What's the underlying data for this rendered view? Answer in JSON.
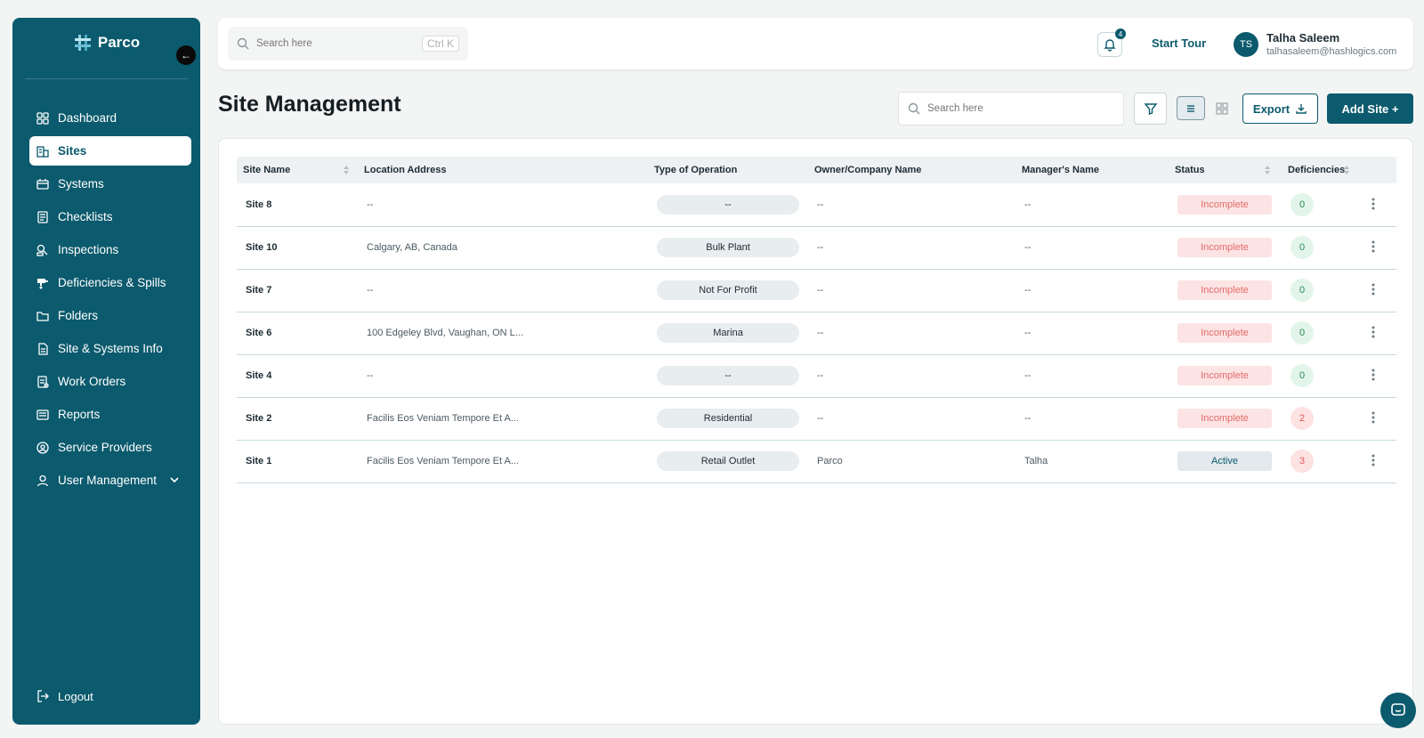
{
  "brand": {
    "name": "Parco"
  },
  "sidebar": {
    "items": [
      {
        "label": "Dashboard",
        "icon": "dashboard-icon"
      },
      {
        "label": "Sites",
        "icon": "building-icon"
      },
      {
        "label": "Systems",
        "icon": "systems-icon"
      },
      {
        "label": "Checklists",
        "icon": "checklist-icon"
      },
      {
        "label": "Inspections",
        "icon": "inspection-icon"
      },
      {
        "label": "Deficiencies & Spills",
        "icon": "spill-icon"
      },
      {
        "label": "Folders",
        "icon": "folder-icon"
      },
      {
        "label": "Site & Systems Info",
        "icon": "document-icon"
      },
      {
        "label": "Work Orders",
        "icon": "work-order-icon"
      },
      {
        "label": "Reports",
        "icon": "report-icon"
      },
      {
        "label": "Service Providers",
        "icon": "provider-icon"
      },
      {
        "label": "User Management",
        "icon": "user-icon"
      }
    ],
    "active": "Sites",
    "logout_label": "Logout"
  },
  "topbar": {
    "search_placeholder": "Search here",
    "shortcut": "Ctrl K",
    "notification_count": "4",
    "start_tour_label": "Start Tour",
    "user": {
      "initials": "TS",
      "name": "Talha Saleem",
      "email": "talhasaleem@hashlogics.com"
    }
  },
  "page": {
    "title": "Site Management",
    "search_placeholder": "Search here",
    "export_label": "Export",
    "add_label": "Add Site +"
  },
  "table": {
    "columns": [
      "Site Name",
      "Location Address",
      "Type of Operation",
      "Owner/Company Name",
      "Manager's Name",
      "Status",
      "Deficiencies"
    ],
    "rows": [
      {
        "site": "Site 8",
        "address": "--",
        "operation": "--",
        "owner": "--",
        "manager": "--",
        "status": "Incomplete",
        "deficiencies": "0"
      },
      {
        "site": "Site 10",
        "address": "Calgary, AB, Canada",
        "operation": "Bulk Plant",
        "owner": "--",
        "manager": "--",
        "status": "Incomplete",
        "deficiencies": "0"
      },
      {
        "site": "Site 7",
        "address": "--",
        "operation": "Not For Profit",
        "owner": "--",
        "manager": "--",
        "status": "Incomplete",
        "deficiencies": "0"
      },
      {
        "site": "Site 6",
        "address": "100 Edgeley Blvd, Vaughan, ON L...",
        "operation": "Marina",
        "owner": "--",
        "manager": "--",
        "status": "Incomplete",
        "deficiencies": "0"
      },
      {
        "site": "Site 4",
        "address": "--",
        "operation": "--",
        "owner": "--",
        "manager": "--",
        "status": "Incomplete",
        "deficiencies": "0"
      },
      {
        "site": "Site 2",
        "address": "Facilis Eos Veniam Tempore Et A...",
        "operation": "Residential",
        "owner": "--",
        "manager": "--",
        "status": "Incomplete",
        "deficiencies": "2"
      },
      {
        "site": "Site 1",
        "address": "Facilis Eos Veniam Tempore Et A...",
        "operation": "Retail Outlet",
        "owner": "Parco",
        "manager": "Talha",
        "status": "Active",
        "deficiencies": "3"
      }
    ]
  },
  "colors": {
    "primary": "#0b5a6d",
    "incomplete": "#e26b6b",
    "background": "#f3f4f4"
  }
}
